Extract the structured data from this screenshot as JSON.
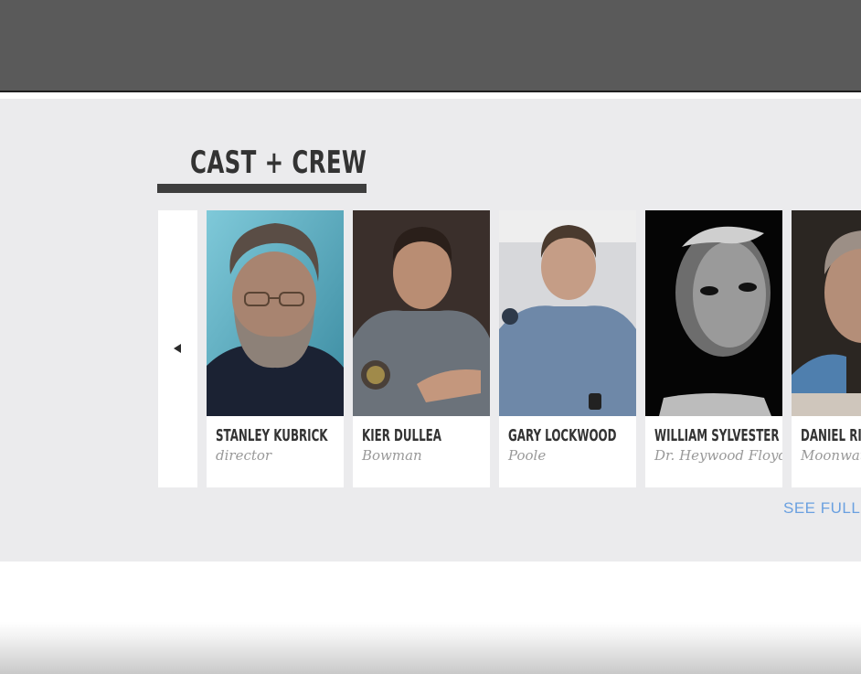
{
  "section": {
    "title": "CAST + CREW",
    "see_full_label": "SEE FULL"
  },
  "carousel": {
    "prev_icon": "triangle-left-icon",
    "cards": [
      {
        "name": "STANLEY KUBRICK",
        "role": "director",
        "photo": "portrait-stanley-kubrick"
      },
      {
        "name": "KIER DULLEA",
        "role": "Bowman",
        "photo": "portrait-kier-dullea"
      },
      {
        "name": "GARY LOCKWOOD",
        "role": "Poole",
        "photo": "portrait-gary-lockwood"
      },
      {
        "name": "WILLIAM SYLVESTER",
        "role": "Dr. Heywood Floyd",
        "photo": "portrait-william-sylvester"
      },
      {
        "name": "DANIEL RIC",
        "role": "Moonwatc",
        "photo": "portrait-daniel-richter"
      }
    ]
  },
  "colors": {
    "topbar": "#5a5a5a",
    "section_bg": "#ebebed",
    "heading": "#333333",
    "role_text": "#999999",
    "link": "#6aa0e0"
  }
}
